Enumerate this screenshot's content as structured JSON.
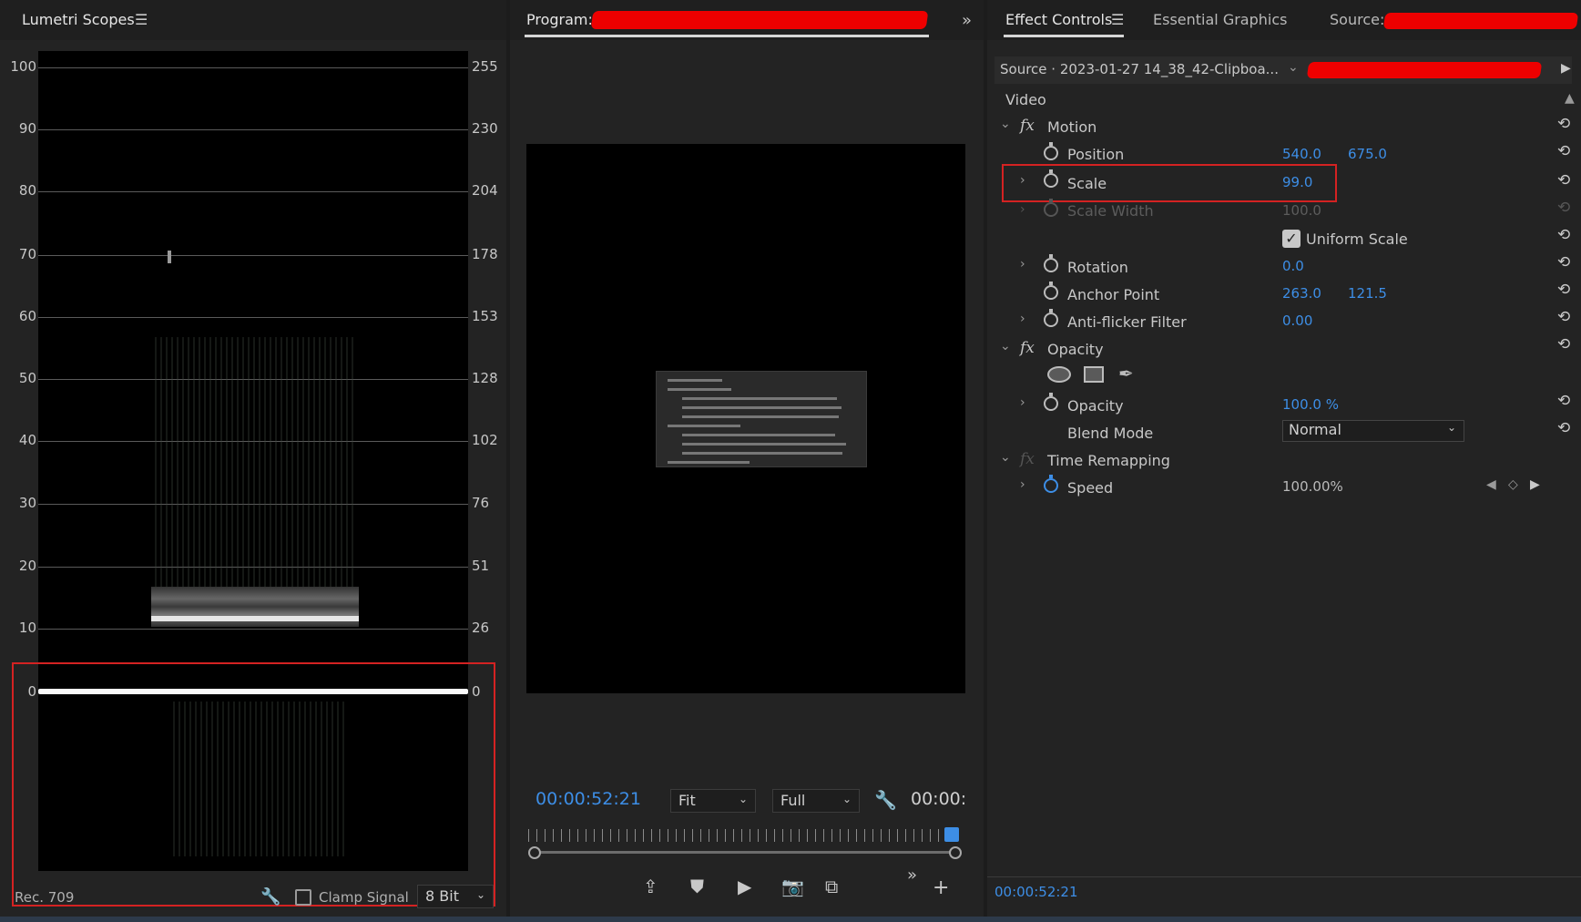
{
  "scopes": {
    "title": "Lumetri Scopes",
    "y_left": [
      "100",
      "90",
      "80",
      "70",
      "60",
      "50",
      "40",
      "30",
      "20",
      "10",
      "0"
    ],
    "y_right": [
      "255",
      "230",
      "204",
      "178",
      "153",
      "128",
      "102",
      "76",
      "51",
      "26",
      "0"
    ],
    "colorspace": "Rec. 709",
    "clamp_label": "Clamp Signal",
    "bit_depth": "8 Bit"
  },
  "program": {
    "title": "Program:",
    "timecode": "00:00:52:21",
    "timecode_right": "00:00:",
    "fit": "Fit",
    "quality": "Full"
  },
  "effects": {
    "tabs": [
      "Effect Controls",
      "Essential Graphics",
      "Source:"
    ],
    "source_label": "Source · 2023-01-27 14_38_42-Clipboa...",
    "section_video": "Video",
    "motion": "Motion",
    "position_label": "Position",
    "position_x": "540.0",
    "position_y": "675.0",
    "scale_label": "Scale",
    "scale_value": "99.0",
    "scale_width_label": "Scale Width",
    "scale_width_value": "100.0",
    "uniform_scale": "Uniform Scale",
    "rotation_label": "Rotation",
    "rotation_value": "0.0",
    "anchor_label": "Anchor Point",
    "anchor_x": "263.0",
    "anchor_y": "121.5",
    "antiflicker_label": "Anti-flicker Filter",
    "antiflicker_value": "0.00",
    "opacity_group": "Opacity",
    "opacity_label": "Opacity",
    "opacity_value": "100.0 %",
    "blend_label": "Blend Mode",
    "blend_value": "Normal",
    "time_remap": "Time Remapping",
    "speed_label": "Speed",
    "speed_value": "100.00%",
    "footer_timecode": "00:00:52:21"
  },
  "colors": {
    "accent": "#3d8ee6",
    "highlight": "#d42222",
    "redaction": "#ee0000"
  }
}
